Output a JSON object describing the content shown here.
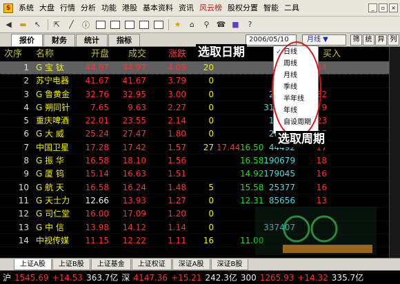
{
  "menu": {
    "items": [
      "系统",
      "大盘",
      "行情",
      "分析",
      "功能",
      "港股",
      "基本资料",
      "资讯",
      "风云榜",
      "股权分置",
      "智能",
      "二具"
    ],
    "hot_index": 8
  },
  "tabs": [
    {
      "label": "报价",
      "active": true
    },
    {
      "label": "财务",
      "active": false
    },
    {
      "label": "统计",
      "active": false
    },
    {
      "label": "指标",
      "active": false
    }
  ],
  "date_value": "2006/05/10 ÷",
  "period_value": "月线 ▼",
  "right_buttons": [
    "筛",
    "统",
    "异",
    "列"
  ],
  "table": {
    "columns": [
      "次序",
      "名称",
      "开盘",
      "成交",
      "涨跌",
      "",
      "成交量",
      "买入"
    ],
    "sorted_column": 4,
    "rows": [
      {
        "idx": "1",
        "name": "G 宝 钛",
        "open": "44.97",
        "last": "44.97",
        "chg": "4.09",
        "c5": "20",
        "vol": "637",
        "buy": "44",
        "sel": true
      },
      {
        "idx": "2",
        "name": "苏宁电器",
        "open": "41.67",
        "last": "41.67",
        "chg": "3.79",
        "c5": "0",
        "vol": "4",
        "buy": ""
      },
      {
        "idx": "3",
        "name": "G 鲁黄金",
        "open": "32.76",
        "last": "32.95",
        "chg": "3.00",
        "c5": "0",
        "vol": "25771",
        "buy": "32"
      },
      {
        "idx": "4",
        "name": "G 朔同针",
        "open": "7.65",
        "last": "9.63",
        "chg": "2.27",
        "c5": "0",
        "vol": "310359",
        "buy": "9"
      },
      {
        "idx": "5",
        "name": "重庆啤酒",
        "open": "22.01",
        "last": "23.55",
        "chg": "2.14",
        "c5": "0",
        "vol": "10583",
        "buy": "23"
      },
      {
        "idx": "6",
        "name": "G 大 威",
        "open": "25.24",
        "last": "27.47",
        "chg": "1.80",
        "c5": "0",
        "vol": "20259",
        "buy": "27"
      },
      {
        "idx": "7",
        "name": "中国卫星",
        "open": "17.28",
        "last": "17.42",
        "chg": "1.57",
        "c5": "27",
        "c6": "17.44",
        "c7": "16.50",
        "vol": "44492",
        "buy": "17"
      },
      {
        "idx": "8",
        "name": "G 振 华",
        "open": "16.58",
        "last": "18.10",
        "chg": "1.56",
        "c5": "",
        "c6": "",
        "c7": "16.58",
        "vol": "190679",
        "buy": "18"
      },
      {
        "idx": "9",
        "name": "G 厦 钨",
        "open": "15.14",
        "last": "16.63",
        "chg": "1.51",
        "c5": "",
        "c6": "",
        "c7": "14.92",
        "vol": "179045",
        "buy": "16"
      },
      {
        "idx": "10",
        "name": "G 航 天",
        "open": "16.58",
        "last": "16.24",
        "chg": "1.48",
        "c5": "5",
        "c6": "",
        "c7": "15.58",
        "vol": "25377",
        "buy": "16"
      },
      {
        "idx": "11",
        "name": "G 天士力",
        "open": "12.66",
        "last": "13.93",
        "chg": "1.27",
        "c5": "0",
        "c6": "",
        "c7": "12.31",
        "vol": "85656",
        "buy": "13"
      },
      {
        "idx": "12",
        "name": "G 司仁堂",
        "open": "16.00",
        "last": "17.09",
        "chg": "1.20",
        "c5": "0",
        "c6": "",
        "c7": "",
        "vol": "",
        "buy": ""
      },
      {
        "idx": "13",
        "name": "G 中 信",
        "open": "13.98",
        "last": "14.12",
        "chg": "1.14",
        "c5": "0",
        "c6": "",
        "c7": "",
        "vol": "337407",
        "buy": ""
      },
      {
        "idx": "14",
        "name": "中视传媒",
        "open": "11.15",
        "last": "12.22",
        "chg": "1.11",
        "c5": "16",
        "c6": "",
        "c7": "11.00",
        "vol": "",
        "buy": ""
      }
    ]
  },
  "market_tabs": [
    {
      "label": "上证A股",
      "active": true
    },
    {
      "label": "上证B股"
    },
    {
      "label": "上证基金"
    },
    {
      "label": "上证权证"
    },
    {
      "label": "深证A股"
    },
    {
      "label": "深证B股"
    }
  ],
  "ticker": {
    "sh_label": "沪",
    "sh_idx": "1545.69",
    "sh_chg": "+14.53",
    "sh_amt": "363.7亿",
    "sz_label": "深",
    "sz_idx": "4147.36",
    "sz_chg": "+15.21",
    "sz_amt": "242.3亿",
    "c_label": "300",
    "c_idx": "1265.93",
    "c_chg": "+14.32",
    "c_amt": "335.7亿"
  },
  "dropdown": {
    "items": [
      "日线",
      "周线",
      "月线",
      "季线",
      "半年线",
      "年线",
      "自设周期"
    ],
    "checked_index": 0
  },
  "annotations": {
    "date_callout": "选取日期",
    "period_callout": "选取周期"
  },
  "colors": {
    "accent_red": "#ff3030",
    "header_yellow": "#c0c040",
    "selected_row": "#606060"
  }
}
